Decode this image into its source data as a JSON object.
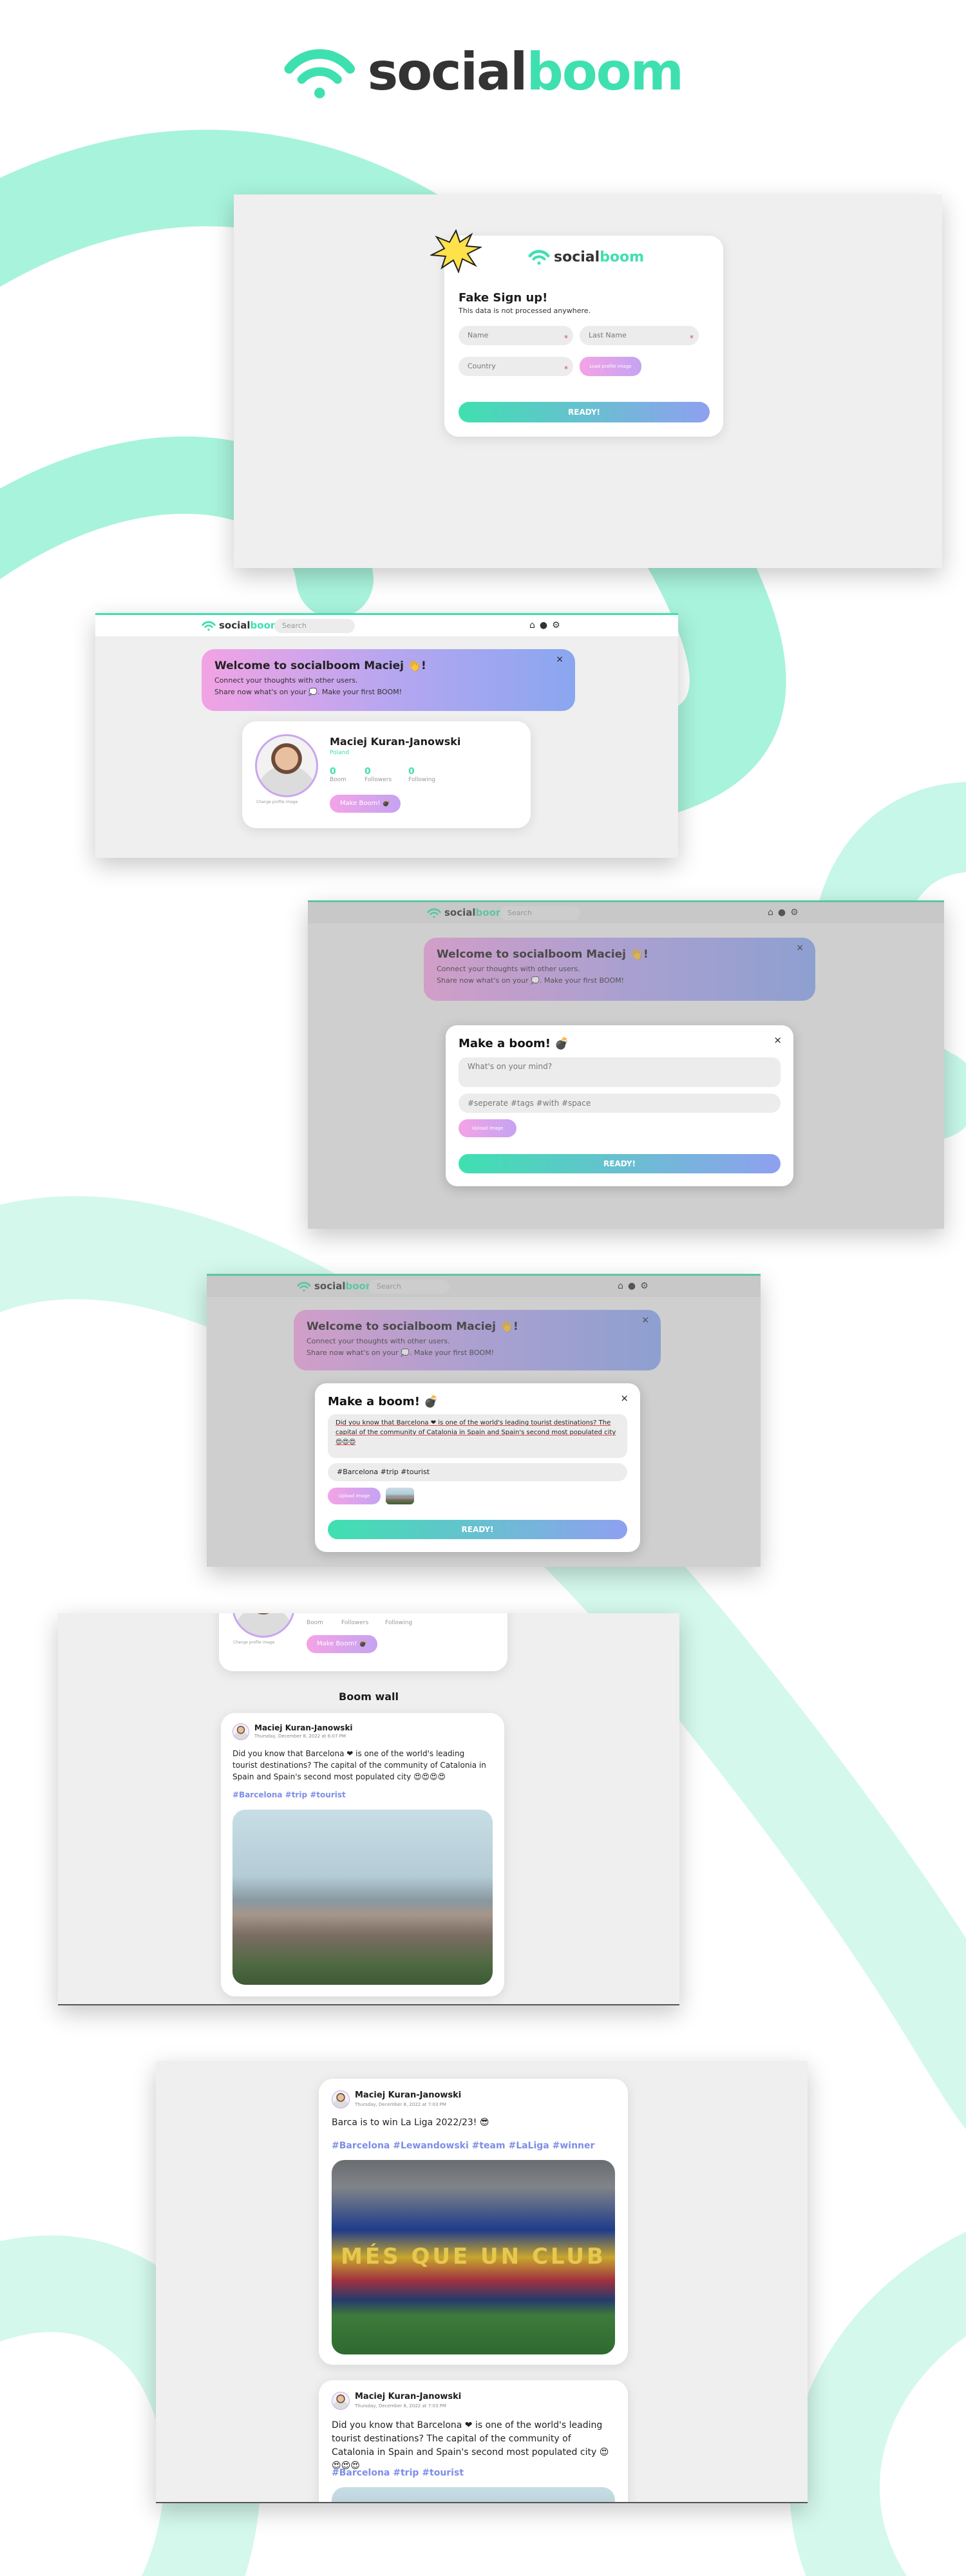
{
  "brand": {
    "social": "social",
    "boom": "boom"
  },
  "signup": {
    "title": "Fake Sign up!",
    "subtitle": "This data is not processed anywhere.",
    "name_placeholder": "Name",
    "lastname_placeholder": "Last Name",
    "country_placeholder": "Country",
    "upload_label": "Load profile image",
    "ready_label": "READY!"
  },
  "navbar": {
    "search_placeholder": "Search"
  },
  "welcome": {
    "title": "Welcome to socialboom Maciej 👋!",
    "line1": "Connect your thoughts with other users.",
    "line2": "Share now what's on your 💭. Make your first BOOM!",
    "close": "×"
  },
  "profile": {
    "name": "Maciej Kuran-Janowski",
    "country": "Poland",
    "avatar_caption": "Change profile image",
    "stats": [
      {
        "value": "0",
        "label": "Boom"
      },
      {
        "value": "0",
        "label": "Followers"
      },
      {
        "value": "0",
        "label": "Following"
      }
    ],
    "make_boom": "Make Boom! 💣"
  },
  "boom_modal_empty": {
    "title": "Make a boom! 💣",
    "text_placeholder": "What's on your mind?",
    "tags_placeholder": "#seperate #tags #with #space",
    "upload_label": "Upload image",
    "ready_label": "READY!",
    "close": "×"
  },
  "boom_modal_filled": {
    "title": "Make a boom! 💣",
    "text": "Did you know that Barcelona ❤ is one of the world's leading tourist destinations? The capital of the community of Catalonia in Spain and Spain's second most populated city 😍😍😍",
    "tags": "#Barcelona #trip #tourist",
    "upload_label": "Upload image",
    "ready_label": "READY!",
    "close": "×"
  },
  "wall": {
    "title": "Boom wall",
    "posts": [
      {
        "author": "Maciej Kuran-Janowski",
        "date": "Thursday, December 8, 2022 at 6:07 PM",
        "text": "Did you know that Barcelona ❤ is one of the world's leading tourist destinations? The capital of the community of Catalonia in Spain and Spain's second most populated city 😍😍😍😍",
        "tags": "#Barcelona #trip #tourist"
      }
    ]
  },
  "feed": {
    "posts": [
      {
        "author": "Maciej Kuran-Janowski",
        "date": "Thursday, December 8, 2022 at 7:03 PM",
        "text": "Barca is to win La Liga 2022/23! 😎",
        "tags": "#Barcelona #Lewandowski #team #LaLiga #winner",
        "photo_text": "MÉS QUE UN CLUB"
      },
      {
        "author": "Maciej Kuran-Janowski",
        "date": "Thursday, December 8, 2022 at 7:03 PM",
        "text": "Did you know that Barcelona ❤ is one of the world's leading tourist destinations? The capital of the community of Catalonia in Spain and Spain's second most populated city 😍😍😍😍",
        "tags": "#Barcelona #trip #tourist"
      }
    ]
  },
  "colors": {
    "accent": "#3fe0b0",
    "purple": "#8fa0f0",
    "pink": "#f4a3e6",
    "background_panel": "#efefef"
  }
}
